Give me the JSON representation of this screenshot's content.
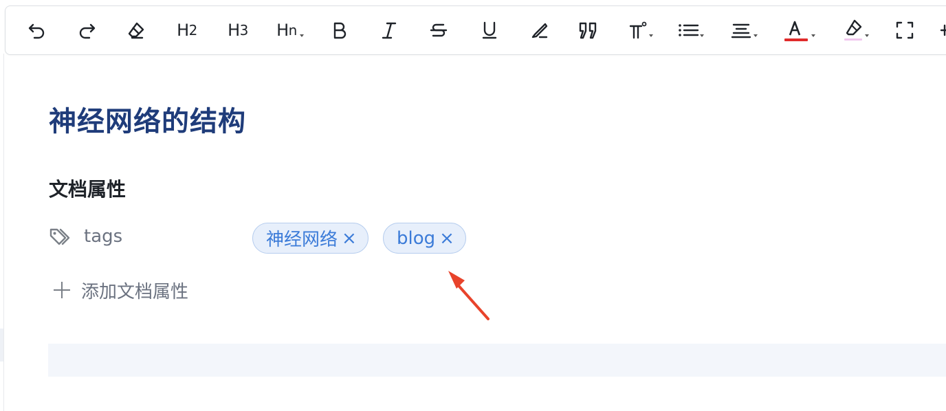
{
  "toolbar": {
    "h2_label": "H",
    "h2_sub": "2",
    "h3_label": "H",
    "h3_sub": "3",
    "hn_label": "H",
    "hn_sub": "n",
    "buttons": [
      "undo-icon",
      "redo-icon",
      "eraser-icon",
      "heading-2",
      "heading-3",
      "heading-n",
      "bold-icon",
      "italic-icon",
      "strikethrough-icon",
      "underline-icon",
      "highlighter-icon",
      "quote-icon",
      "code-icon",
      "list-icon",
      "align-icon",
      "font-color-icon",
      "background-color-icon",
      "fullscreen-icon"
    ],
    "font_color": "#e02b2b",
    "highlight_color": "#f0c6ee"
  },
  "document": {
    "title": "神经网络的结构",
    "title_color": "#1f3c7a",
    "section_title": "文档属性"
  },
  "properties": {
    "tags_label": "tags",
    "tags": [
      {
        "label": "神经网络",
        "remove": "×"
      },
      {
        "label": "blog",
        "remove": "×"
      }
    ],
    "chip_color": "#3b7bd8",
    "add_property_label": "添加文档属性"
  },
  "annotation": {
    "arrow_color": "#e8432b"
  }
}
